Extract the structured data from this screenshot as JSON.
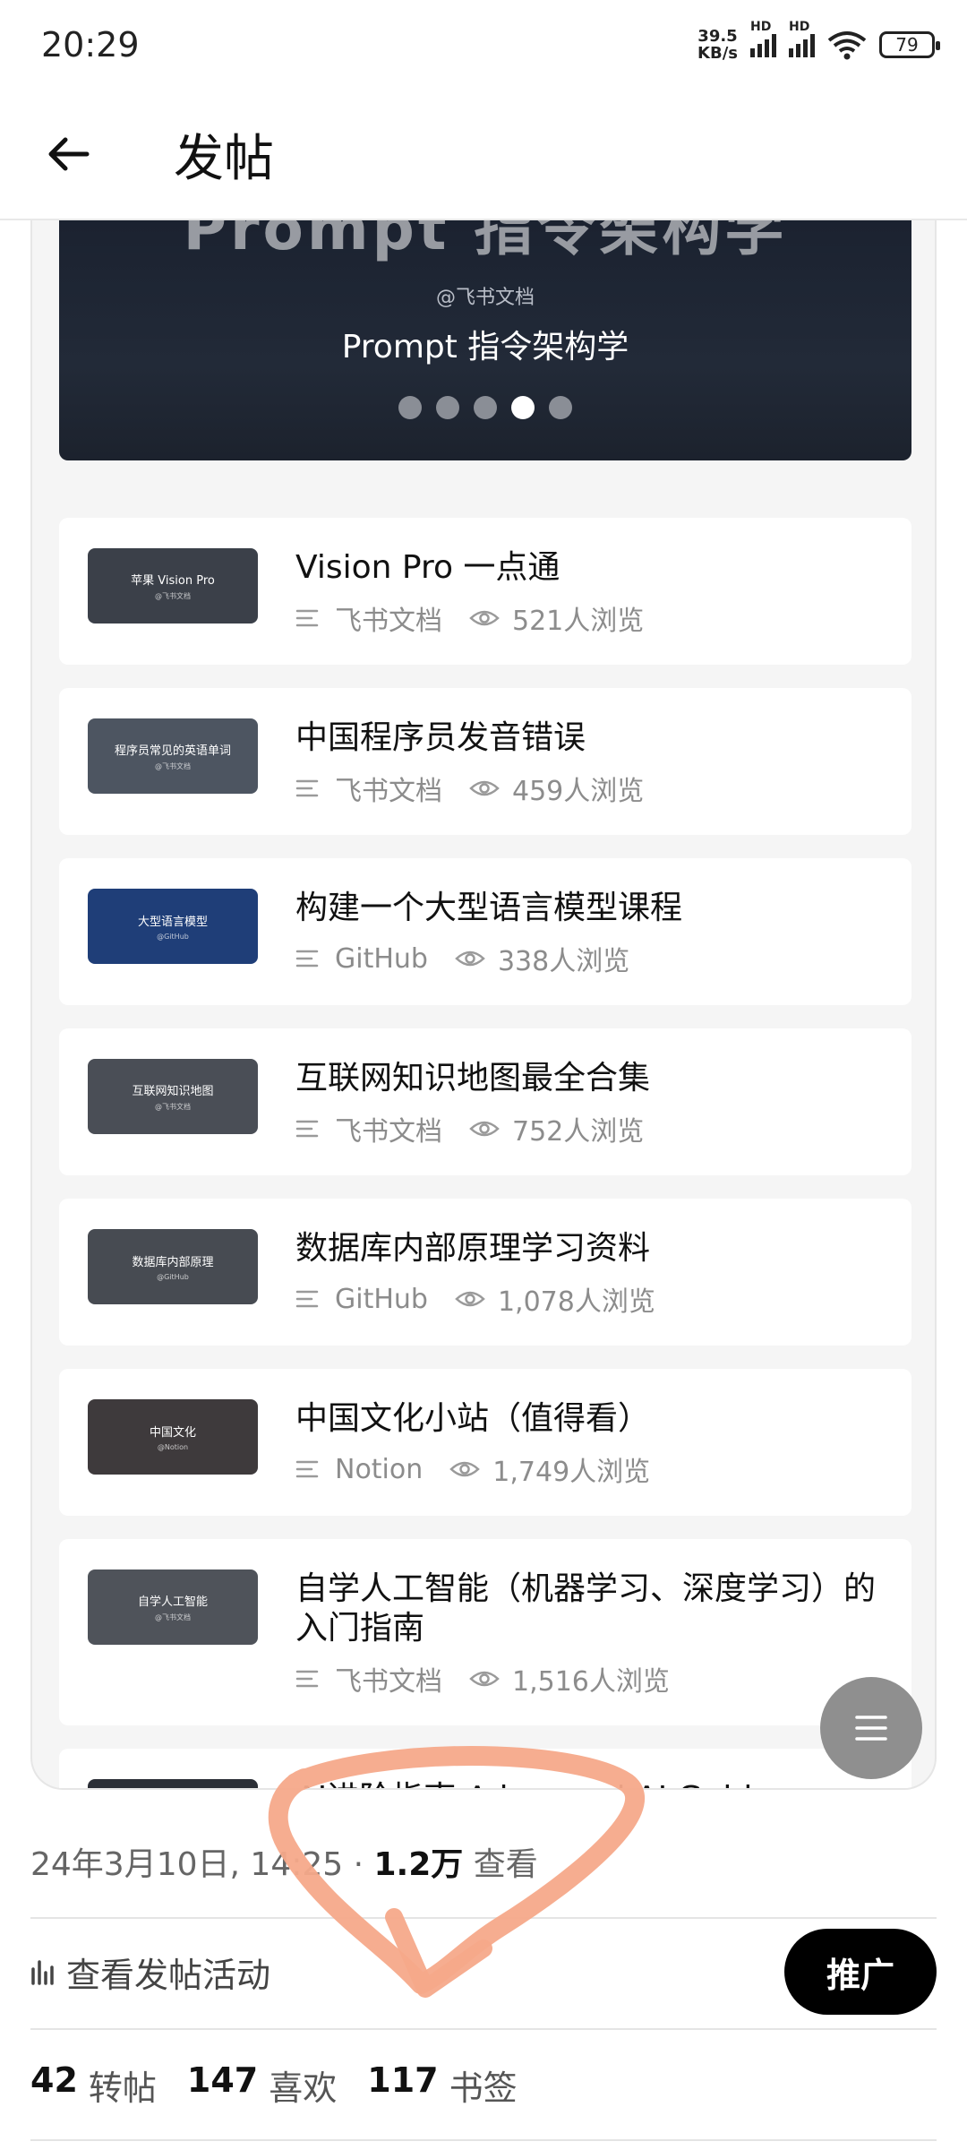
{
  "status_bar": {
    "time": "20:29",
    "net_speed_value": "39.5",
    "net_speed_unit": "KB/s",
    "hd1": "HD",
    "hd2": "HD",
    "battery": "79"
  },
  "header": {
    "title": "发帖"
  },
  "banner": {
    "cut_title": "Prompt 指令架构学",
    "source": "@飞书文档",
    "title": "Prompt 指令架构学",
    "dot_count": 5,
    "active_dot": 4
  },
  "docs": [
    {
      "thumb_text": "苹果 Vision Pro",
      "thumb_sub": "@飞书文档",
      "thumb_color": "#3b4049",
      "title": "Vision Pro 一点通",
      "source": "飞书文档",
      "views": "521人浏览"
    },
    {
      "thumb_text": "程序员常见的英语单词",
      "thumb_sub": "@飞书文档",
      "thumb_color": "#4d5561",
      "title": "中国程序员发音错误",
      "source": "飞书文档",
      "views": "459人浏览"
    },
    {
      "thumb_text": "大型语言模型",
      "thumb_sub": "@GitHub",
      "thumb_color": "#1f3e78",
      "title": "构建一个大型语言模型课程",
      "source": "GitHub",
      "views": "338人浏览"
    },
    {
      "thumb_text": "互联网知识地图",
      "thumb_sub": "@飞书文档",
      "thumb_color": "#4a4e56",
      "title": "互联网知识地图最全合集",
      "source": "飞书文档",
      "views": "752人浏览"
    },
    {
      "thumb_text": "数据库内部原理",
      "thumb_sub": "@GitHub",
      "thumb_color": "#474b52",
      "title": "数据库内部原理学习资料",
      "source": "GitHub",
      "views": "1,078人浏览"
    },
    {
      "thumb_text": "中国文化",
      "thumb_sub": "@Notion",
      "thumb_color": "#3e3a3c",
      "title": "中国文化小站（值得看）",
      "source": "Notion",
      "views": "1,749人浏览"
    },
    {
      "thumb_text": "自学人工智能",
      "thumb_sub": "@飞书文档",
      "thumb_color": "#4f535a",
      "title": "自学人工智能（机器学习、深度学习）的入门指南",
      "source": "飞书文档",
      "views": "1,516人浏览"
    },
    {
      "thumb_text": "",
      "thumb_sub": "",
      "thumb_color": "#2b2f36",
      "title": "AI进阶指南 Advanced AI Guide",
      "source": "",
      "views": ""
    }
  ],
  "post": {
    "date": "24年3月10日, 14:25",
    "sep": " · ",
    "views_num": "1.2万",
    "views_label": " 查看",
    "activity_label": "查看发帖活动",
    "promote_label": "推广",
    "reposts_num": "42",
    "reposts_label": "转帖",
    "likes_num": "147",
    "likes_label": "喜欢",
    "bookmarks_num": "117",
    "bookmarks_label": "书签"
  },
  "colors": {
    "annotation_stroke": "#f5a98a",
    "promote_bg": "#000000",
    "fab_bg": "#8f8f8f"
  }
}
